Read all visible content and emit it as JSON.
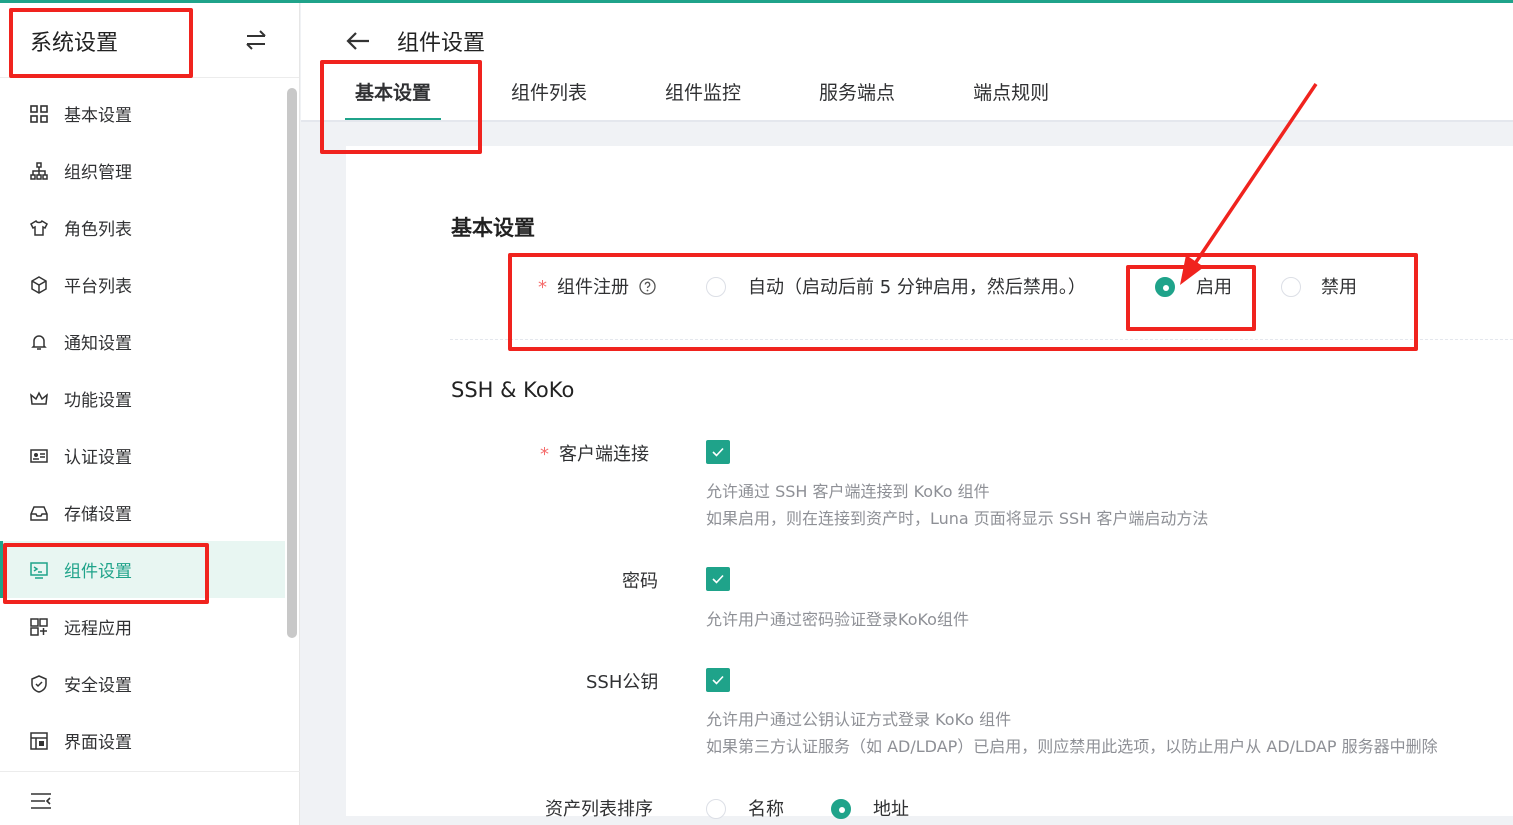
{
  "sidebar": {
    "title": "系统设置",
    "items": [
      {
        "label": "基本设置",
        "icon": "grid-icon"
      },
      {
        "label": "组织管理",
        "icon": "org-tree-icon"
      },
      {
        "label": "角色列表",
        "icon": "shirt-icon"
      },
      {
        "label": "平台列表",
        "icon": "cube-icon"
      },
      {
        "label": "通知设置",
        "icon": "bell-icon"
      },
      {
        "label": "功能设置",
        "icon": "crown-icon"
      },
      {
        "label": "认证设置",
        "icon": "id-card-icon"
      },
      {
        "label": "存储设置",
        "icon": "inbox-icon"
      },
      {
        "label": "组件设置",
        "icon": "terminal-icon",
        "active": true
      },
      {
        "label": "远程应用",
        "icon": "apps-icon"
      },
      {
        "label": "安全设置",
        "icon": "shield-icon"
      },
      {
        "label": "界面设置",
        "icon": "palette-icon"
      }
    ]
  },
  "header": {
    "title": "组件设置",
    "tabs": [
      "基本设置",
      "组件列表",
      "组件监控",
      "服务端点",
      "端点规则"
    ]
  },
  "basic": {
    "title": "基本设置",
    "registration": {
      "label": "组件注册",
      "help_icon": "question-circle-icon",
      "options": [
        "自动（启动后前 5 分钟启用，然后禁用。）",
        "启用",
        "禁用"
      ],
      "selected": "启用"
    }
  },
  "ssh": {
    "title": "SSH & KoKo",
    "client": {
      "label": "客户端连接",
      "checked": true,
      "help1": "允许通过 SSH 客户端连接到 KoKo 组件",
      "help2": "如果启用，则在连接到资产时，Luna 页面将显示 SSH 客户端启动方法"
    },
    "password": {
      "label": "密码",
      "checked": true,
      "help1": "允许用户通过密码验证登录KoKo组件"
    },
    "pubkey": {
      "label": "SSH公钥",
      "checked": true,
      "help1": "允许用户通过公钥认证方式登录 KoKo 组件",
      "help2": "如果第三方认证服务（如 AD/LDAP）已启用，则应禁用此选项，以防止用户从 AD/LDAP 服务器中删除"
    },
    "sort": {
      "label": "资产列表排序",
      "options": [
        "名称",
        "地址"
      ],
      "selected": "地址"
    }
  },
  "colors": {
    "accent": "#1fa38a",
    "annotation": "#f0231e",
    "required": "#f56c6c"
  }
}
